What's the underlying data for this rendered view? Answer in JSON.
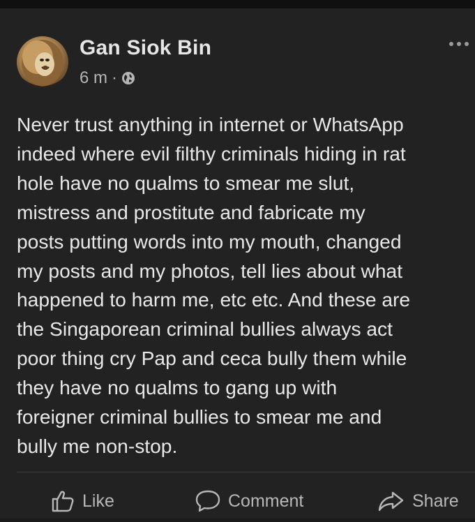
{
  "post": {
    "author": "Gan Siok Bin",
    "time": "6 m",
    "separator": "·",
    "privacy_icon": "globe-icon",
    "text": "Never trust anything in internet or WhatsApp\nindeed where evil filthy criminals hiding in rat\nhole have no qualms to smear me slut,\nmistress and prostitute and fabricate my\nposts putting words into my mouth, changed\nmy posts and my photos, tell lies about what\nhappened to harm me, etc etc. And these are\nthe Singaporean criminal bullies always act\npoor thing cry Pap and ceca bully them while\nthey have no qualms to gang up with\nforeigner criminal bullies to smear me and\nbully me non-stop."
  },
  "actions": {
    "like_label": "Like",
    "comment_label": "Comment",
    "share_label": "Share"
  },
  "colors": {
    "background": "#222222",
    "text": "#e8e8e8",
    "secondary": "#b5b5b5"
  }
}
